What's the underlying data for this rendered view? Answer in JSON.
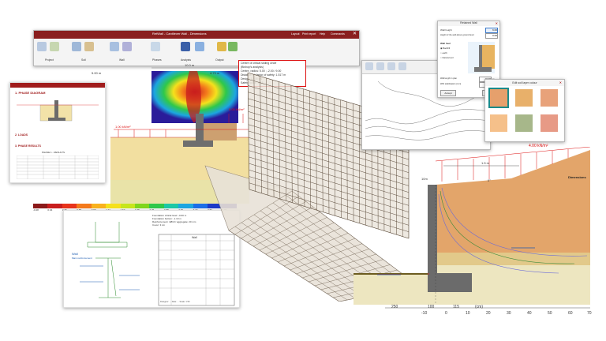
{
  "app": {
    "window_title": "RetWall - Cantilever Wall - Dimensions",
    "menu_right": [
      "Layout",
      "Print report",
      "Help",
      "Commands"
    ],
    "ribbon_groups": [
      "Project",
      "Soil",
      "Wall",
      "Phases",
      "Analysis",
      "Output"
    ],
    "ribbon_labels": [
      "Analysis",
      "Phase Labels",
      "Unit Weights",
      "Verification"
    ]
  },
  "report": {
    "title": "1. PHASE DIAGRAM",
    "sections": [
      "2. LOADS",
      "3. PHASE RESULTS"
    ],
    "table_title": "PHASE 1 - RESULTS"
  },
  "stress_plot": {
    "dims": [
      "10.0 m",
      "4.73 m"
    ],
    "load_left": "1.00 kN/m²",
    "load_right": "0.00 kN/m²",
    "wall_left": "5.00 m",
    "legend_values": [
      "-0.28",
      "0.04",
      "0.36",
      "0.68",
      "0.99",
      "1.31",
      "1.63",
      "1.95",
      "2.26",
      "2.58",
      "2.90",
      "3.22",
      "3.54",
      "3.86"
    ],
    "legend_colors": [
      "#8b1a1a",
      "#c81e1e",
      "#e8341c",
      "#f47a1c",
      "#f9b21e",
      "#f5e11c",
      "#c7e61c",
      "#7fd61c",
      "#2fc84a",
      "#1cc8a6",
      "#1ca6e1",
      "#1c6ee8",
      "#1c3ac8",
      "#2a1c9a"
    ]
  },
  "stability_note": {
    "lines": [
      "Centre of critical sliding circle",
      "(Bishop's analysis)",
      "Centre, radius: 5.00 ; -2.00 / 9.00",
      "Distance (x) factor of safety: 1.517 m",
      "Design: 12.05 kN",
      "Safety factor: 3.48 ..."
    ]
  },
  "drawing": {
    "title": "Wall",
    "subtitle": "Main reinforcement",
    "notes": [
      "Foundation critical level: -0.60 m",
      "Foundation bottom: -1.10 m",
      "Reinforcement: 4Ø10 / aggregate: 20 mm",
      "Cover: 3 cm"
    ],
    "bar_schedule_title": "Wall",
    "footer": "Designer: ...    Date: ...    Scale: 1:50"
  },
  "dialog_geometry": {
    "title": "Retained Wall",
    "fields": [
      {
        "label": "Wall height",
        "value": "6.00"
      },
      {
        "label": "Height of the wall above ground level",
        "value": "0.00"
      }
    ],
    "wall_heel_label": "Wall heel",
    "radio_options": [
      "Backfill",
      "earth",
      "Natural soil"
    ],
    "bottom_fields": [
      {
        "label": "Wall length in plan",
        "value": "10.00",
        "unit": "m"
      },
      {
        "label": "With stabilisation (mm)",
        "value": "1.00",
        "unit": "m"
      }
    ],
    "accept": "Accept",
    "cancel": "Cancel"
  },
  "dialog_layers": {
    "title": "Edit soil layer colour",
    "colors": [
      "#e6a06c",
      "#e8b06a",
      "#e8a27a",
      "#f5c08a",
      "#a7b78a",
      "#e79a86"
    ]
  },
  "section": {
    "load": "4.00 kN/m²",
    "dim_top": "1.5 m",
    "left_label": "10m",
    "title": "Dimensions",
    "x_ticks": [
      "-10",
      "0",
      "10",
      "20",
      "30",
      "40",
      "50",
      "60",
      "70"
    ],
    "dim_bottom": [
      "250",
      "100",
      "115",
      "(cm)"
    ],
    "angle": "0°"
  }
}
